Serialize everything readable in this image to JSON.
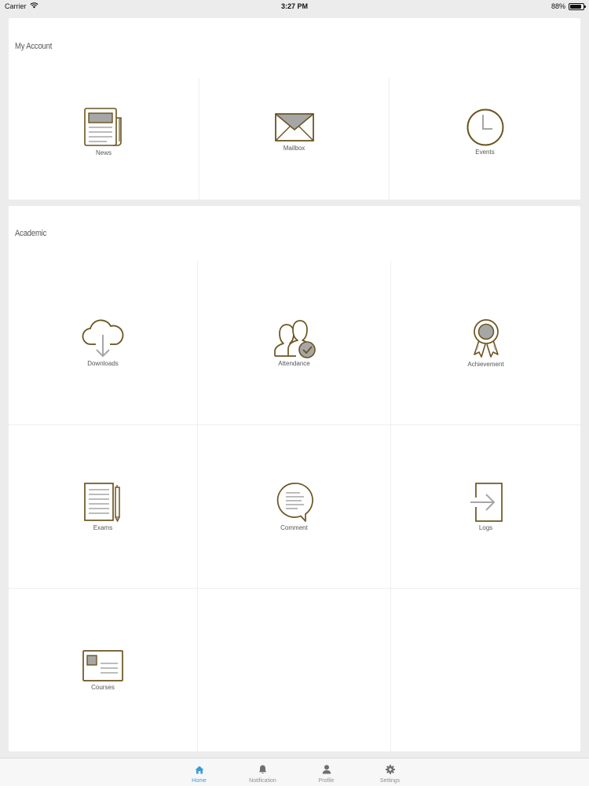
{
  "status_bar": {
    "carrier": "Carrier",
    "time": "3:27 PM",
    "battery": "88%",
    "battery_level": 0.88
  },
  "colors": {
    "icon_stroke": "#6b5420",
    "icon_fill": "#a6a6a6",
    "active_tab": "#3b9dd8",
    "inactive_tab": "#8e8e8e"
  },
  "my_account": {
    "title": "My Account",
    "items": [
      {
        "label": "News",
        "icon": "newspaper-icon"
      },
      {
        "label": "Mailbox",
        "icon": "envelope-icon"
      },
      {
        "label": "Events",
        "icon": "clock-icon"
      }
    ]
  },
  "academic": {
    "title": "Academic",
    "items": [
      {
        "label": "Downloads",
        "icon": "cloud-download-icon"
      },
      {
        "label": "Attendance",
        "icon": "users-check-icon"
      },
      {
        "label": "Achievement",
        "icon": "award-ribbon-icon"
      },
      {
        "label": "Exams",
        "icon": "paper-pencil-icon"
      },
      {
        "label": "Comment",
        "icon": "speech-bubble-icon"
      },
      {
        "label": "Logs",
        "icon": "login-door-icon"
      },
      {
        "label": "Courses",
        "icon": "id-card-icon"
      }
    ]
  },
  "tab_bar": {
    "tabs": [
      {
        "label": "Home",
        "icon": "home-icon",
        "active": true
      },
      {
        "label": "Notification",
        "icon": "bell-icon",
        "active": false
      },
      {
        "label": "Profile",
        "icon": "person-icon",
        "active": false
      },
      {
        "label": "Settings",
        "icon": "gear-icon",
        "active": false
      }
    ]
  }
}
